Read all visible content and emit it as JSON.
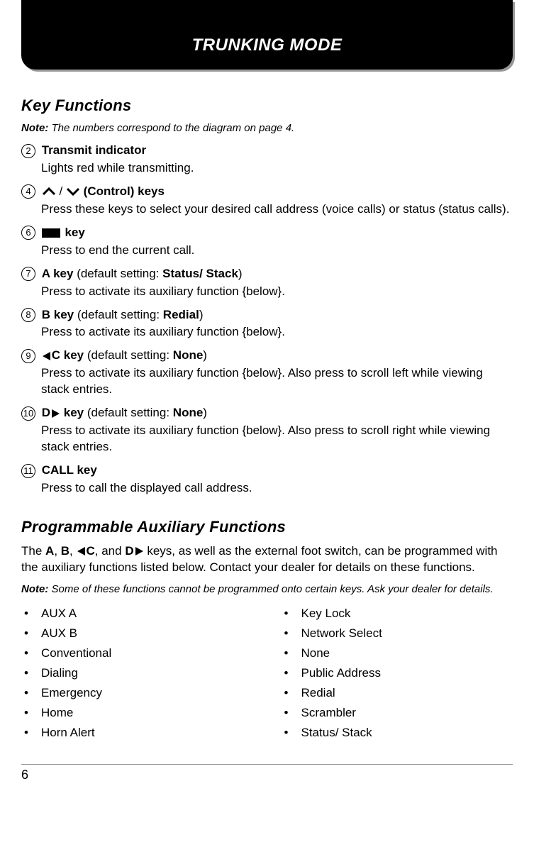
{
  "header": {
    "title": "TRUNKING MODE"
  },
  "sections": {
    "keyFunctions": {
      "title": "Key Functions",
      "note_label": "Note:",
      "note_text": "  The numbers correspond to the diagram on page 4.",
      "items": {
        "n2": {
          "num": "2",
          "title": "Transmit indicator",
          "desc": "Lights red while transmitting."
        },
        "n4": {
          "num": "4",
          "sep": " / ",
          "title": " (Control) keys",
          "desc": "Press these keys to select your desired call address (voice calls) or status (status calls)."
        },
        "n6": {
          "num": "6",
          "title": " key",
          "desc": "Press to end the current call."
        },
        "n7": {
          "num": "7",
          "title_a": "A key",
          "title_b": " (default setting:  ",
          "title_c": "Status/ Stack",
          "title_d": ")",
          "desc": "Press to activate its auxiliary function {below}."
        },
        "n8": {
          "num": "8",
          "title_a": "B key",
          "title_b": " (default setting:  ",
          "title_c": "Redial",
          "title_d": ")",
          "desc": "Press to activate its auxiliary function {below}."
        },
        "n9": {
          "num": "9",
          "title_a": "C key",
          "title_b": " (default setting:  ",
          "title_c": "None",
          "title_d": ")",
          "desc": "Press to activate its auxiliary function {below}.  Also press to scroll left while viewing stack entries."
        },
        "n10": {
          "num": "10",
          "title_a": " key",
          "title_pre": "D",
          "title_b": " (default setting:  ",
          "title_c": "None",
          "title_d": ")",
          "desc": "Press to activate its auxiliary function {below}.  Also press to scroll right while viewing stack entries."
        },
        "n11": {
          "num": "11",
          "title": "CALL key",
          "desc": "Press to call the displayed call address."
        }
      }
    },
    "aux": {
      "title": "Programmable Auxiliary Functions",
      "intro_a": "The ",
      "intro_b": "A",
      "intro_c": ", ",
      "intro_d": "B",
      "intro_e": ", ",
      "intro_f": "C",
      "intro_g": ", and ",
      "intro_h": "D",
      "intro_i": " keys, as well as the external foot switch, can be programmed with the auxiliary functions listed below.  Contact your dealer for details on these functions.",
      "note_label": "Note:",
      "note_text": "  Some of these functions cannot be programmed onto certain keys. Ask your dealer for details.",
      "left": [
        "AUX A",
        "AUX B",
        "Conventional",
        "Dialing",
        "Emergency",
        "Home",
        "Horn Alert"
      ],
      "right": [
        "Key Lock",
        "Network Select",
        "None",
        "Public Address",
        "Redial",
        "Scrambler",
        "Status/ Stack"
      ]
    }
  },
  "footer": {
    "page": "6"
  }
}
